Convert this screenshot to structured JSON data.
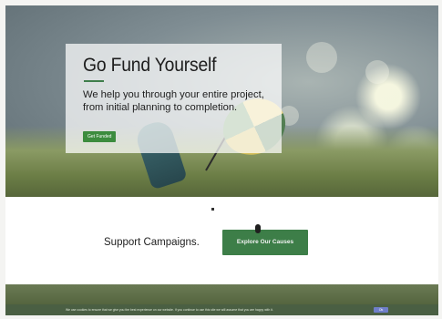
{
  "hero": {
    "title": "Go Fund Yourself",
    "subtitle": "We help you through your entire project, from initial planning to completion.",
    "cta_label": "Get Funded"
  },
  "support": {
    "label": "Support Campaigns.",
    "button_label": "Explore Our Causes"
  },
  "cookie": {
    "message": "We use cookies to ensure that we give you the best experience on our website. If you continue to use this site we will assume that you are happy with it.",
    "ok_label": "Ok"
  },
  "colors": {
    "brand_green": "#3d7e48",
    "cookie_button": "#6f7ec9"
  }
}
